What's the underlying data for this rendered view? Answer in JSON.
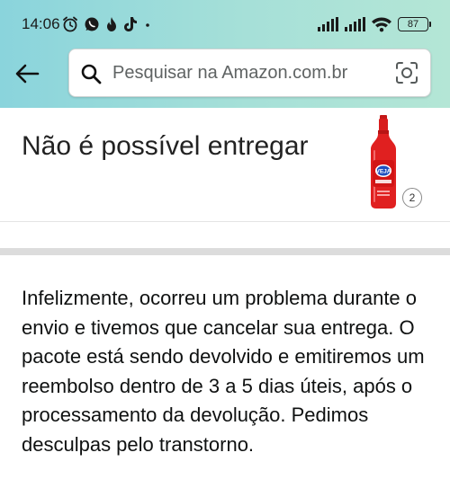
{
  "status_bar": {
    "time": "14:06",
    "notification_icons": [
      "alarm-clock-icon",
      "whatsapp-icon",
      "flame-icon",
      "tiktok-icon",
      "dot-icon"
    ],
    "system_icons": [
      "signal-icon",
      "signal-icon",
      "wifi-icon",
      "battery-icon"
    ],
    "battery_level": "87"
  },
  "colors": {
    "header_gradient_start": "#8ad4dc",
    "header_gradient_end": "#b4e6d6",
    "text_primary": "#0f1111",
    "product_red": "#e02020"
  },
  "nav": {
    "back_icon": "back-arrow-icon"
  },
  "search": {
    "placeholder": "Pesquisar na Amazon.com.br",
    "value": "",
    "left_icon": "search-icon",
    "right_icon": "camera-lens-icon"
  },
  "order": {
    "title": "Não é possível entregar",
    "product_brand": "VEJA",
    "product_quantity": "2",
    "message": "Infelizmente, ocorreu um problema durante o envio e tivemos que cancelar sua entrega. O pacote está sendo devolvido e emitiremos um reembolso dentro de 3 a 5 dias úteis, após o processamento da devolução. Pedimos desculpas pelo transtorno."
  }
}
